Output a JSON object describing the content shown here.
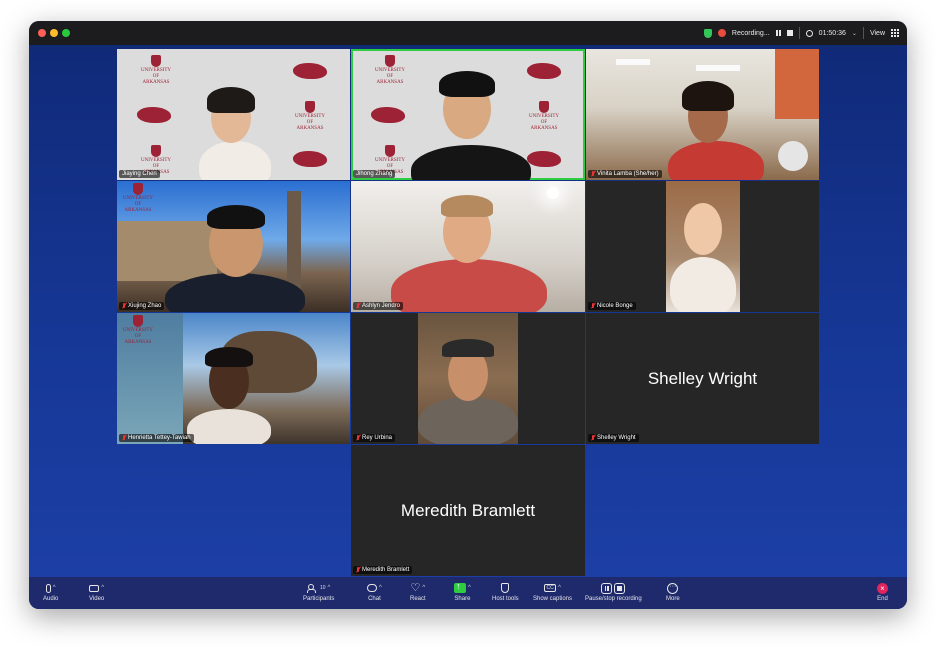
{
  "titlebar": {
    "recording_label": "Recording...",
    "timer": "01:50:36",
    "view_label": "View"
  },
  "tiles": [
    {
      "name": "Jiaying Chen",
      "muted": false,
      "active_speaker": false
    },
    {
      "name": "Jihong Zhang",
      "muted": false,
      "active_speaker": true
    },
    {
      "name": "Vinita Lamba (She/her)",
      "muted": true,
      "active_speaker": false
    },
    {
      "name": "Xiujing Zhao",
      "muted": true,
      "active_speaker": false
    },
    {
      "name": "Ashlyn Jendro",
      "muted": true,
      "active_speaker": false
    },
    {
      "name": "Nicole Bonge",
      "muted": true,
      "active_speaker": false
    },
    {
      "name": "Henrietta Tettey-Tawiah",
      "muted": true,
      "active_speaker": false
    },
    {
      "name": "Rey Urbina",
      "muted": true,
      "active_speaker": false
    },
    {
      "name": "Shelley Wright",
      "muted": true,
      "active_speaker": false,
      "display_name": "Shelley Wright"
    },
    {
      "name": "Meredith Bramlett",
      "muted": true,
      "active_speaker": false,
      "display_name": "Meredith Bramlett"
    }
  ],
  "logo": {
    "line1": "UNIVERSITY OF",
    "line2": "ARKANSAS"
  },
  "toolbar": {
    "audio": "Audio",
    "video": "Video",
    "participants": "Participants",
    "participants_count": "10",
    "chat": "Chat",
    "react": "React",
    "share": "Share",
    "host_tools": "Host tools",
    "captions": "Show captions",
    "recording": "Pause/stop recording",
    "more": "More",
    "end": "End"
  },
  "colors": {
    "active_speaker": "#2ecc40",
    "share": "#2ecc40",
    "end": "#e0245e",
    "brand_red": "#9d2235"
  }
}
